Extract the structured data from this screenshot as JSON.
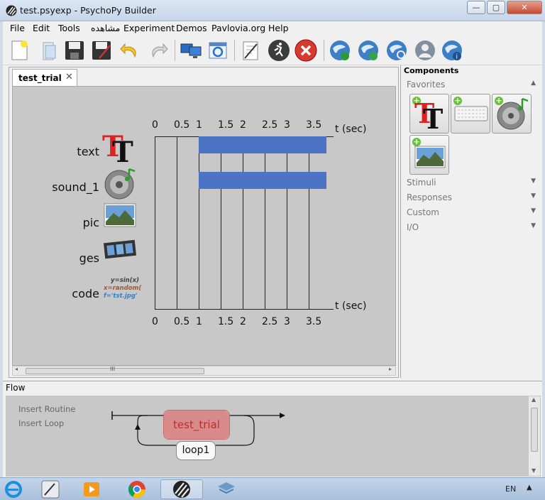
{
  "window": {
    "title": "test.psyexp - PsychoPy Builder"
  },
  "menu": [
    "File",
    "Edit",
    "Tools",
    "مشاهده",
    "Experiment",
    "Demos",
    "Pavlovia.org",
    "Help"
  ],
  "toolbar": {
    "items": [
      "new-file-icon",
      "open-file-icon",
      "save-icon",
      "save-as-icon",
      "undo-icon",
      "redo-icon",
      "monitor-center-icon",
      "experiment-settings-icon",
      "compile-script-icon",
      "run-icon",
      "stop-icon",
      "pavlovia-sync-icon",
      "pavlovia-refresh-icon",
      "pavlovia-search-icon",
      "pavlovia-user-icon",
      "pavlovia-info-icon"
    ]
  },
  "routine": {
    "tab_label": "test_trial",
    "tab_close": "✕",
    "time_unit": "t (sec)",
    "ticks": [
      "0",
      "0.5",
      "1",
      "1.5",
      "2",
      "2.5",
      "3",
      "3.5"
    ],
    "components": [
      {
        "name": "text",
        "start": 1.0,
        "stop": 3.9
      },
      {
        "name": "sound_1",
        "start": 1.0,
        "stop": 3.9
      },
      {
        "name": "pic",
        "start": null,
        "stop": null
      },
      {
        "name": "ges",
        "start": null,
        "stop": null
      },
      {
        "name": "code",
        "start": null,
        "stop": null
      }
    ],
    "code_icon_lines": [
      "y=sin(x)",
      "x=random(",
      "f='tst.jpg'"
    ],
    "scroll_thumb": "III"
  },
  "components_panel": {
    "title": "Components",
    "categories": [
      "Favorites",
      "Stimuli",
      "Responses",
      "Custom",
      "I/O"
    ],
    "favorites": [
      "text-component-icon",
      "keyboard-component-icon",
      "sound-component-icon",
      "image-component-icon"
    ]
  },
  "flow": {
    "label": "Flow",
    "insert_routine": "Insert Routine",
    "insert_loop": "Insert Loop",
    "routine_name": "test_trial",
    "loop_name": "loop1"
  },
  "taskbar": {
    "apps": [
      "ie-icon",
      "tool-icon",
      "media-player-icon",
      "chrome-icon",
      "psychopy-icon",
      "explorer-icon"
    ],
    "language": "EN"
  },
  "colors": {
    "bar": "#4d73c5",
    "routine_box": "#d98b8b",
    "routine_text": "#b8302e"
  }
}
